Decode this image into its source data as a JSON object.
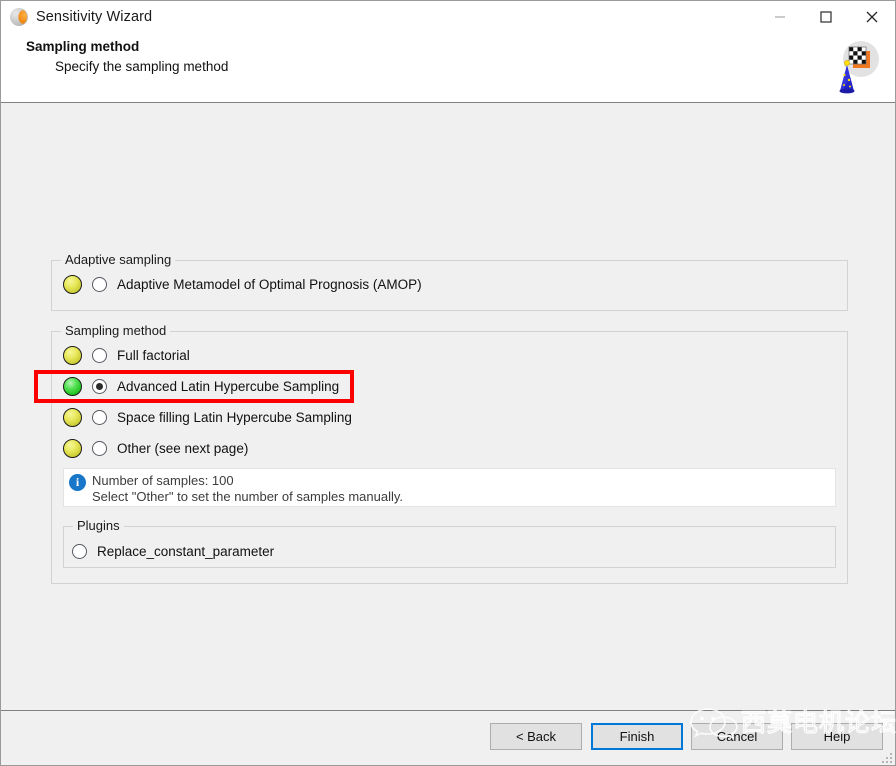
{
  "window": {
    "title": "Sensitivity Wizard",
    "app_icon": "sphere-logo-icon",
    "controls": {
      "minimize": "minimize-icon",
      "maximize": "maximize-icon",
      "close": "close-icon"
    }
  },
  "header": {
    "title": "Sampling method",
    "subtitle": "Specify the sampling method",
    "graphic": "wizard-hat-checkerboard-icon"
  },
  "groups": {
    "adaptive": {
      "legend": "Adaptive sampling",
      "options": [
        {
          "label": "Adaptive Metamodel of Optimal Prognosis (AMOP)",
          "indicator": "yellow",
          "checked": false
        }
      ]
    },
    "sampling": {
      "legend": "Sampling method",
      "options": [
        {
          "label": "Full factorial",
          "indicator": "yellow",
          "checked": false
        },
        {
          "label": "Advanced Latin Hypercube Sampling",
          "indicator": "green",
          "checked": true
        },
        {
          "label": "Space filling Latin Hypercube Sampling",
          "indicator": "yellow",
          "checked": false
        },
        {
          "label": "Other (see next page)",
          "indicator": "yellow",
          "checked": false
        }
      ]
    },
    "plugins": {
      "legend": "Plugins",
      "options": [
        {
          "label": "Replace_constant_parameter",
          "checked": false
        }
      ]
    }
  },
  "info": {
    "icon": "info-icon",
    "line1": "Number of samples: 100",
    "line2": "Select \"Other\" to set the number of samples manually."
  },
  "highlight": {
    "color": "#fc0000",
    "target": "Advanced Latin Hypercube Sampling"
  },
  "footer": {
    "buttons": [
      {
        "label": "< Back",
        "default": false
      },
      {
        "label": "Finish",
        "default": true
      },
      {
        "label": "Cancel",
        "default": false
      },
      {
        "label": "Help",
        "default": false
      }
    ]
  },
  "watermark": {
    "text": "西莫电机论坛",
    "logo": "wechat-icon"
  }
}
